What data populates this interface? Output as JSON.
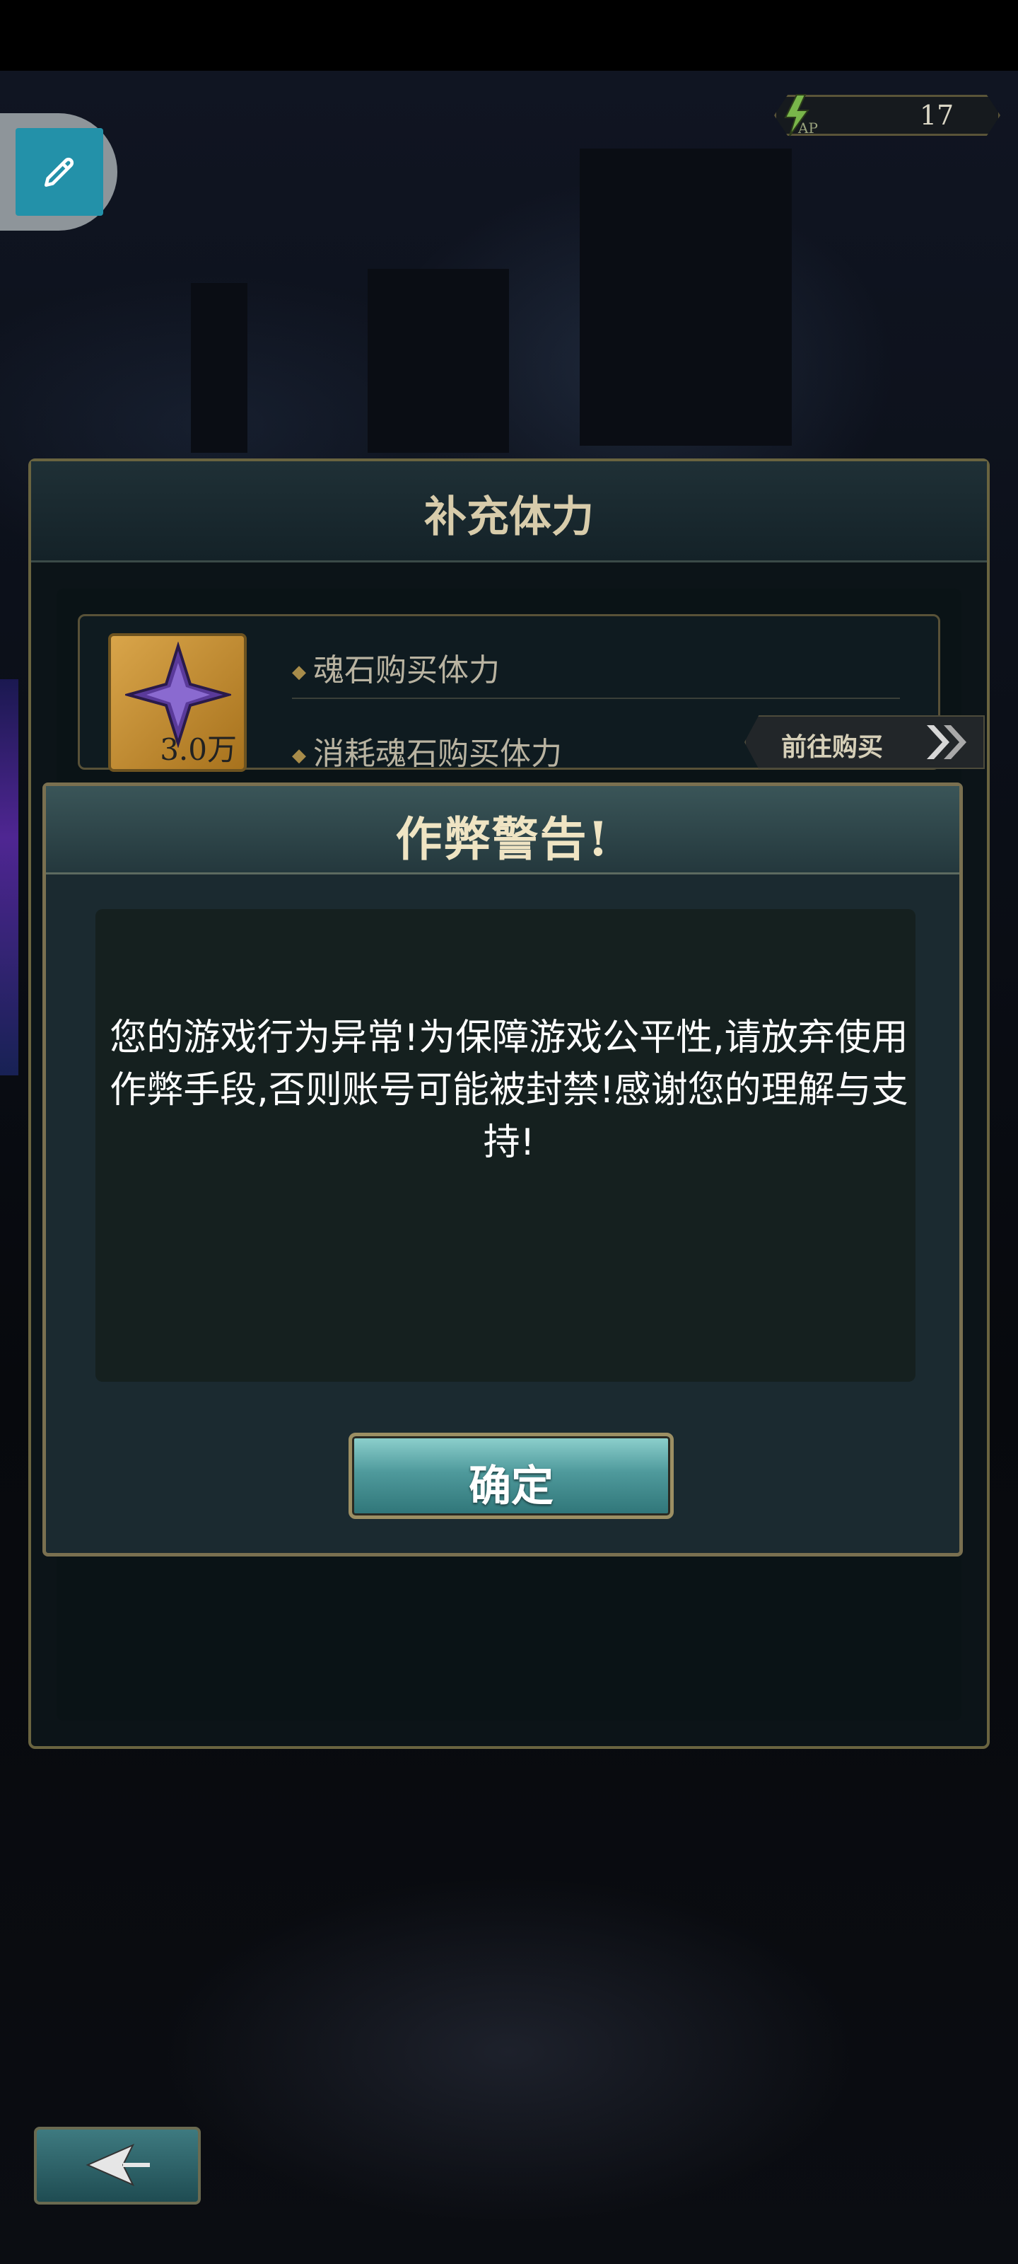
{
  "hud": {
    "ap": {
      "icon": "lightning-ap-icon",
      "label": "AP",
      "value": "17"
    },
    "edit_tool": {
      "icon": "eyedropper-icon"
    }
  },
  "refill_panel": {
    "title": "补充体力",
    "item": {
      "icon": "soul-stone-icon",
      "count": "3.0万",
      "rows": [
        "魂石购买体力",
        "消耗魂石购买体力"
      ],
      "buy_button": "前往购买"
    }
  },
  "dialog": {
    "title": "作弊警告!",
    "message": "您的游戏行为异常!为保障游戏公平性,请放弃使用作弊手段,否则账号可能被封禁!感谢您的理解与支持!",
    "confirm_button": "确定"
  },
  "footer": {
    "back_icon": "back-arrow-icon"
  },
  "colors": {
    "accent_teal": "#2391a9",
    "gold_border": "#7a7050",
    "dialog_bg": "#1b2a30"
  }
}
